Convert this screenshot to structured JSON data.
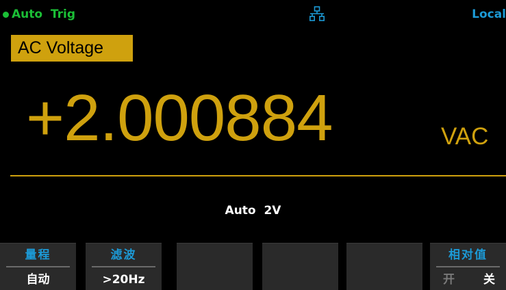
{
  "status_bar": {
    "trigger_label": "Auto  Trig",
    "trigger_color": "#1bbf36",
    "network_icon": "network-icon",
    "remote_label": "Local",
    "remote_color": "#1c9ad6"
  },
  "function": {
    "title": "AC Voltage",
    "accent_color": "#cfa10e"
  },
  "reading": {
    "value": "+2.000884",
    "unit": "VAC"
  },
  "range_info": "Auto  2V",
  "softkeys": [
    {
      "title": "量程",
      "value": "自动"
    },
    {
      "title": "滤波",
      "value": ">20Hz"
    },
    {
      "title": "",
      "value": ""
    },
    {
      "title": "",
      "value": ""
    },
    {
      "title": "",
      "value": ""
    },
    {
      "title": "相对值",
      "options": [
        "开",
        "关"
      ],
      "selected": "关"
    }
  ]
}
